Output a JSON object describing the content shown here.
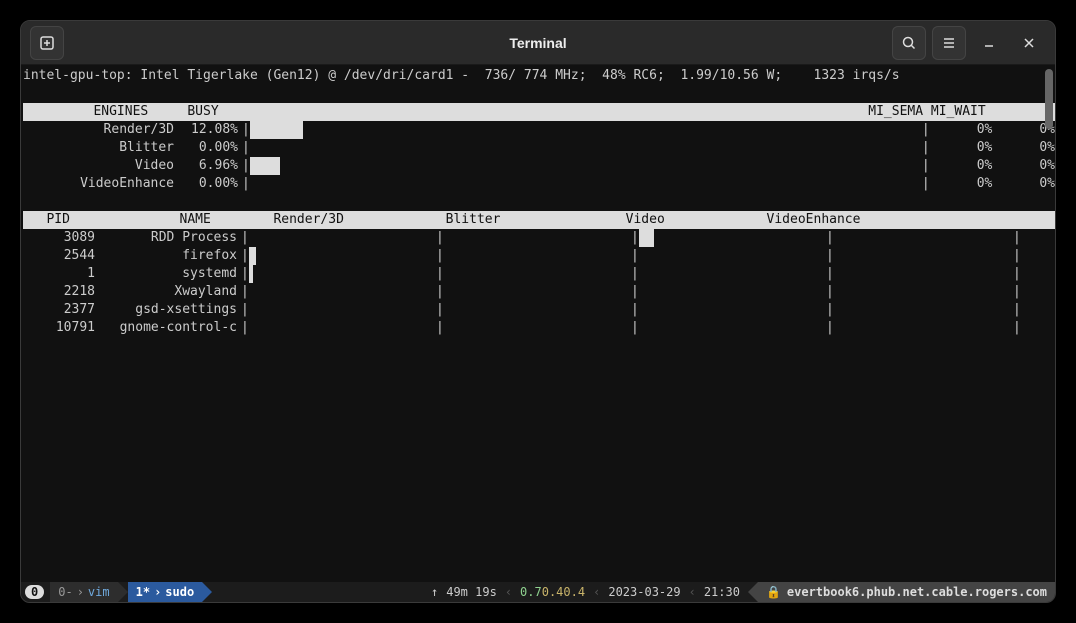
{
  "window": {
    "title": "Terminal"
  },
  "summary_line": "intel-gpu-top: Intel Tigerlake (Gen12) @ /dev/dri/card1 -  736/ 774 MHz;  48% RC6;  1.99/10.56 W;    1323 irqs/s",
  "engines_header": "         ENGINES     BUSY                                                                                   MI_SEMA MI_WAIT",
  "engines": [
    {
      "name": "Render/3D",
      "busy": "12.08%",
      "mi_sema": "0%",
      "mi_wait": "0%",
      "fill_pct": 12.08
    },
    {
      "name": "Blitter",
      "busy": "0.00%",
      "mi_sema": "0%",
      "mi_wait": "0%",
      "fill_pct": 0
    },
    {
      "name": "Video",
      "busy": "6.96%",
      "mi_sema": "0%",
      "mi_wait": "0%",
      "fill_pct": 6.96
    },
    {
      "name": "VideoEnhance",
      "busy": "0.00%",
      "mi_sema": "0%",
      "mi_wait": "0%",
      "fill_pct": 0
    }
  ],
  "proc_header": "   PID              NAME        Render/3D             Blitter                Video             VideoEnhance      ",
  "processes": [
    {
      "pid": "3089",
      "name": "RDD Process",
      "render_fill": 0,
      "video_fill": 8
    },
    {
      "pid": "2544",
      "name": "firefox",
      "render_fill": 4,
      "video_fill": 0
    },
    {
      "pid": "1",
      "name": "systemd",
      "render_fill": 2,
      "video_fill": 0
    },
    {
      "pid": "2218",
      "name": "Xwayland",
      "render_fill": 0,
      "video_fill": 0
    },
    {
      "pid": "2377",
      "name": "gsd-xsettings",
      "render_fill": 0,
      "video_fill": 0
    },
    {
      "pid": "10791",
      "name": "gnome-control-c",
      "render_fill": 0,
      "video_fill": 0
    }
  ],
  "status": {
    "session_badge": "0",
    "tab0": "0-",
    "tab0_cmd": "vim",
    "tab1": "1*",
    "tab1_cmd": "sudo",
    "uptime_arrow": "↑",
    "uptime": "49m 19s",
    "load": [
      "0.7",
      "0.4",
      "0.4"
    ],
    "date": "2023-03-29",
    "time": "21:30",
    "host": "evertbook6.phub.net.cable.rogers.com"
  }
}
